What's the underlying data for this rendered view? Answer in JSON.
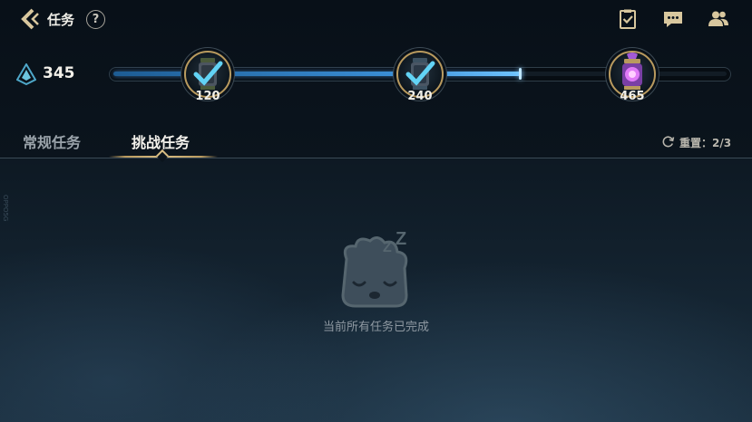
{
  "header": {
    "title": "任务",
    "help_label": "?"
  },
  "top_icons": [
    "clipboard-check-icon",
    "chat-bubble-icon",
    "friends-icon"
  ],
  "progress": {
    "points": "345",
    "current": 345,
    "max": 465,
    "milestones": [
      {
        "label": "120",
        "value": 120,
        "claimed": true,
        "icon": "lantern-reward-icon"
      },
      {
        "label": "240",
        "value": 240,
        "claimed": true,
        "icon": "lantern-reward-icon"
      },
      {
        "label": "465",
        "value": 465,
        "claimed": false,
        "icon": "purple-lantern-reward-icon"
      }
    ]
  },
  "tabs": [
    {
      "label": "常规任务",
      "active": false
    },
    {
      "label": "挑战任务",
      "active": true
    }
  ],
  "reset": {
    "label": "重置：2/3"
  },
  "empty_state": {
    "message": "当前所有任务已完成"
  },
  "side_mark": "OPPO5G",
  "colors": {
    "gold": "#b99a5e",
    "progress_blue": "#3b8fd6",
    "check_cyan": "#62d3f5",
    "reward_purple": "#c04cf0"
  }
}
